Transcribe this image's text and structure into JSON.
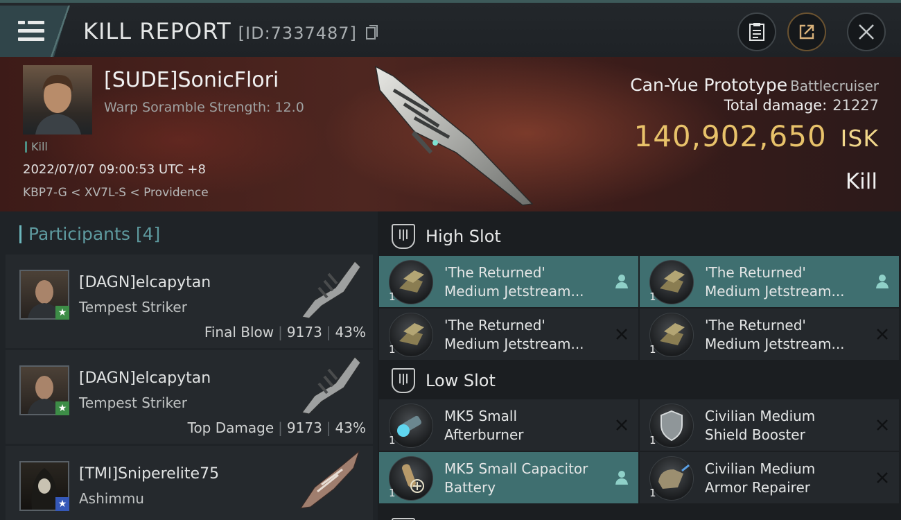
{
  "header": {
    "title": "KILL REPORT",
    "report_id": "[ID:7337487]"
  },
  "victim": {
    "name": "[SUDE]SonicFlori",
    "scramble": "Warp Soramble Strength: 12.0",
    "tag": "Kill",
    "datetime": "2022/07/07 09:00:53 UTC +8",
    "route": "KBP7-G < XV7L-S < Providence",
    "ship_name": "Can-Yue Prototype",
    "ship_class": "Battlecruiser",
    "total_damage_label": "Total damage:",
    "total_damage_value": "21227",
    "isk_value": "140,902,650",
    "isk_unit": "ISK",
    "result": "Kill"
  },
  "participants": {
    "label": "Participants",
    "count": "[4]",
    "items": [
      {
        "name": "[DAGN]elcapytan",
        "ship": "Tempest Striker",
        "role": "Final Blow",
        "damage": "9173",
        "percent": "43%",
        "badge": "★"
      },
      {
        "name": "[DAGN]elcapytan",
        "ship": "Tempest Striker",
        "role": "Top Damage",
        "damage": "9173",
        "percent": "43%",
        "badge": "★"
      },
      {
        "name": "[TMI]Sniperelite75",
        "ship": "Ashimmu",
        "badge": "★"
      }
    ]
  },
  "slots": {
    "high": {
      "title": "High Slot",
      "items": [
        {
          "line1": "'The Returned'",
          "line2": "Medium Jetstream...",
          "qty": "1",
          "state": "dropped"
        },
        {
          "line1": "'The Returned'",
          "line2": "Medium Jetstream...",
          "qty": "1",
          "state": "dropped"
        },
        {
          "line1": "'The Returned'",
          "line2": "Medium Jetstream...",
          "qty": "1",
          "state": "destroyed"
        },
        {
          "line1": "'The Returned'",
          "line2": "Medium Jetstream...",
          "qty": "1",
          "state": "destroyed"
        }
      ]
    },
    "low": {
      "title": "Low Slot",
      "items": [
        {
          "line1": "MK5 Small",
          "line2": "Afterburner",
          "qty": "1",
          "state": "destroyed"
        },
        {
          "line1": "Civilian Medium",
          "line2": "Shield Booster",
          "qty": "1",
          "state": "destroyed"
        },
        {
          "line1": "MK5 Small Capacitor",
          "line2": "Battery",
          "qty": "1",
          "state": "dropped"
        },
        {
          "line1": "Civilian Medium",
          "line2": "Armor Repairer",
          "qty": "1",
          "state": "destroyed"
        }
      ]
    }
  },
  "colors": {
    "accent_teal": "#3f6f70",
    "isk_gold": "#e8c26a",
    "participants_teal": "#5e9a9f"
  }
}
